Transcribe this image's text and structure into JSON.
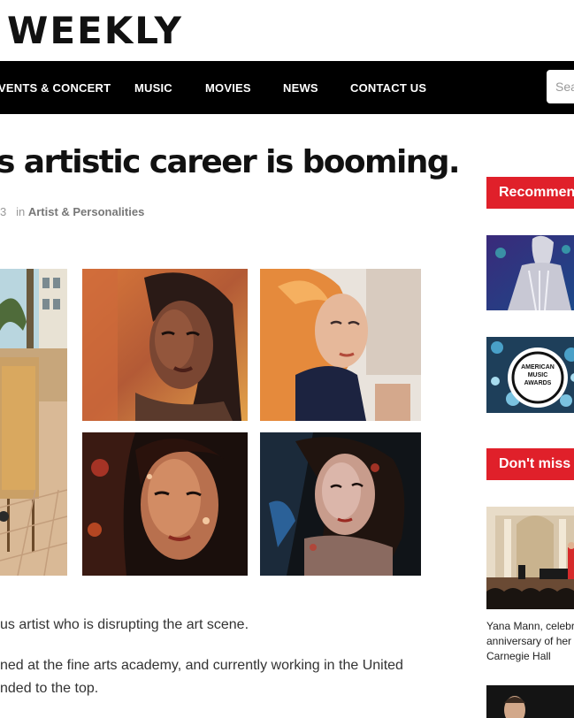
{
  "site": {
    "logo_text": "WEEKLY"
  },
  "nav": {
    "items": [
      "VENTS & CONCERT",
      "MUSIC",
      "MOVIES",
      "NEWS",
      "CONTACT US"
    ],
    "search_placeholder": "Sea"
  },
  "article": {
    "title": "s artistic career is booming.",
    "meta_date": "3",
    "meta_in": "in",
    "meta_category": "Artist & Personalities",
    "paragraphs": [
      "us artist who is disrupting the art scene.",
      "ned at the fine arts academy, and currently working in the United",
      "nded to the top."
    ]
  },
  "sidebar": {
    "recommended_heading": "Recommende",
    "dont_miss_heading": "Don't miss i",
    "awards_badge": [
      "AMERICAN",
      "MUSIC",
      "AWARDS"
    ],
    "dont_miss_caption": [
      "Yana Mann, celebra",
      "anniversary of her d",
      "Carnegie Hall"
    ]
  },
  "colors": {
    "nav_bg": "#000000",
    "accent_red": "#e0202a",
    "text_dark": "#111111"
  }
}
